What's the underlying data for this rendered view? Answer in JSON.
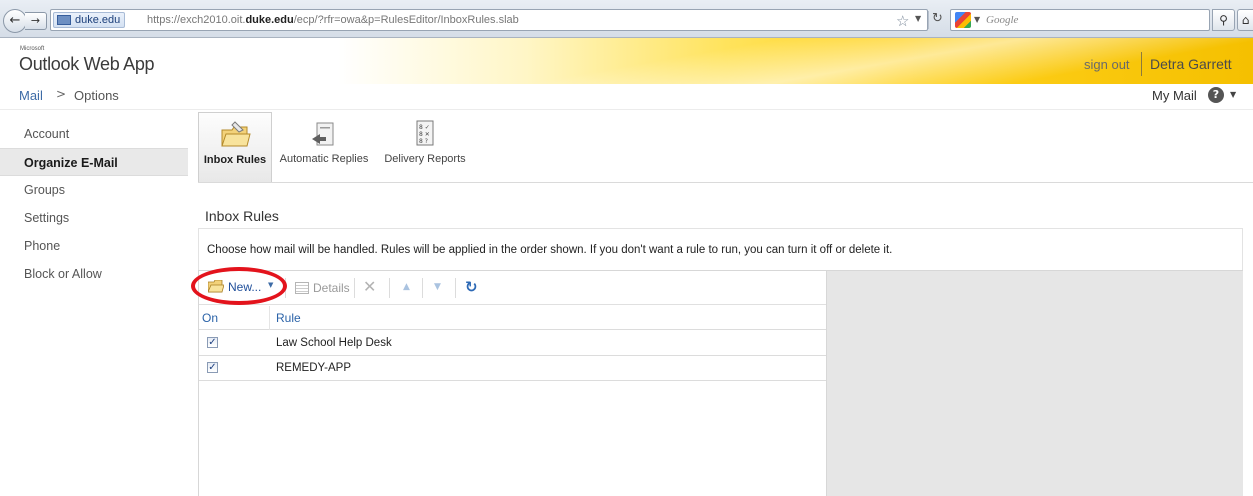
{
  "browser": {
    "site_identity": "duke.edu",
    "url_prefix": "https://exch2010.oit.",
    "url_domain": "duke.edu",
    "url_suffix": "/ecp/?rfr=owa&p=RulesEditor/InboxRules.slab",
    "search_placeholder": "Google"
  },
  "header": {
    "brand_small": "Microsoft",
    "app_title": "Outlook Web App",
    "sign_out": "sign out",
    "user_name": "Detra Garrett"
  },
  "breadcrumb": {
    "root": "Mail",
    "separator": ">",
    "current": "Options",
    "my_mail": "My Mail",
    "help_glyph": "?"
  },
  "sidebar": {
    "items": [
      {
        "label": "Account"
      },
      {
        "label": "Organize E-Mail"
      },
      {
        "label": "Groups"
      },
      {
        "label": "Settings"
      },
      {
        "label": "Phone"
      },
      {
        "label": "Block or Allow"
      }
    ],
    "selected_index": 1
  },
  "tabs": [
    {
      "label": "Inbox Rules",
      "icon": "folder-rules-icon"
    },
    {
      "label": "Automatic Replies",
      "icon": "auto-reply-icon"
    },
    {
      "label": "Delivery Reports",
      "icon": "delivery-report-icon"
    }
  ],
  "content": {
    "section_title": "Inbox Rules",
    "description": "Choose how mail will be handled. Rules will be applied in the order shown. If you don't want a rule to run, you can turn it off or delete it."
  },
  "toolbar": {
    "new_label": "New...",
    "details_label": "Details",
    "highlight_color": "#e3131c"
  },
  "rules_table": {
    "columns": [
      "On",
      "Rule"
    ],
    "rows": [
      {
        "on": true,
        "rule": "Law School Help Desk"
      },
      {
        "on": true,
        "rule": "REMEDY-APP"
      }
    ]
  }
}
